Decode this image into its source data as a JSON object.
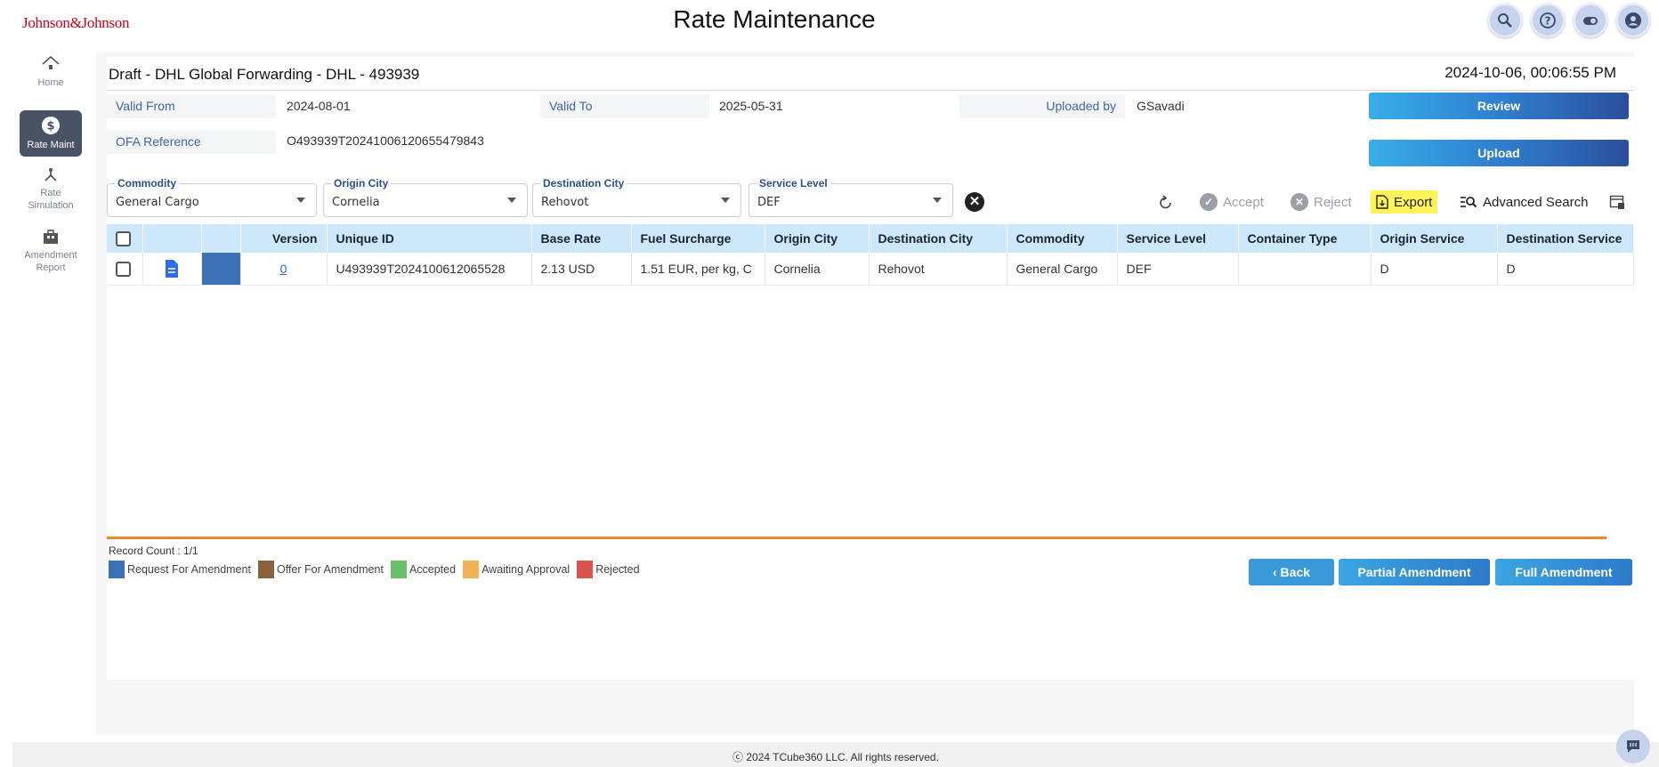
{
  "header": {
    "brand": "Johnson&Johnson",
    "title": "Rate Maintenance",
    "icons": [
      "search-icon",
      "help-icon",
      "toggle-icon",
      "user-icon"
    ]
  },
  "sidebar": {
    "items": [
      {
        "label": "Home",
        "icon": "home-icon"
      },
      {
        "label": "Rate Maint",
        "icon": "dollar-icon",
        "active": true
      },
      {
        "label": "Rate Simulation",
        "icon": "simulation-icon"
      },
      {
        "label": "Amendment Report",
        "icon": "report-icon"
      }
    ]
  },
  "draft": {
    "title": "Draft - DHL Global Forwarding - DHL - 493939",
    "timestamp": "2024-10-06, 00:06:55 PM"
  },
  "info": {
    "valid_from_label": "Valid From",
    "valid_from": "2024-08-01",
    "valid_to_label": "Valid To",
    "valid_to": "2025-05-31",
    "uploaded_by_label": "Uploaded by",
    "uploaded_by": "GSavadi",
    "ofa_label": "OFA Reference",
    "ofa": "O493939T20241006120655479843"
  },
  "actions": {
    "review": "Review",
    "upload": "Upload"
  },
  "filters": {
    "commodity": {
      "label": "Commodity",
      "value": "General Cargo"
    },
    "origin_city": {
      "label": "Origin City",
      "value": "Cornelia"
    },
    "destination_city": {
      "label": "Destination City",
      "value": "Rehovot"
    },
    "service_level": {
      "label": "Service Level",
      "value": "DEF"
    }
  },
  "toolbar": {
    "accept": "Accept",
    "reject": "Reject",
    "export": "Export",
    "advanced_search": "Advanced Search"
  },
  "table": {
    "headers": [
      "Version",
      "Unique ID",
      "Base Rate",
      "Fuel Surcharge",
      "Origin City",
      "Destination City",
      "Commodity",
      "Service Level",
      "Container Type",
      "Origin Service",
      "Destination Service"
    ],
    "rows": [
      {
        "version": "0",
        "unique_id": "U493939T2024100612065528",
        "base_rate": "2.13 USD",
        "fuel_surcharge": "1.51 EUR, per kg, C",
        "origin_city": "Cornelia",
        "destination_city": "Rehovot",
        "commodity": "General Cargo",
        "service_level": "DEF",
        "container_type": "",
        "origin_service": "D",
        "destination_service": "D",
        "status_color": "#3c71b6"
      }
    ]
  },
  "record_count": "Record Count : 1/1",
  "legend": [
    {
      "label": "Request For Amendment",
      "color": "#3c71b6"
    },
    {
      "label": "Offer For Amendment",
      "color": "#8b6239"
    },
    {
      "label": "Accepted",
      "color": "#6abf69"
    },
    {
      "label": "Awaiting Approval",
      "color": "#f0b358"
    },
    {
      "label": "Rejected",
      "color": "#d9534f"
    }
  ],
  "bottom_buttons": {
    "back": "Back",
    "partial": "Partial Amendment",
    "full": "Full Amendment"
  },
  "footer": "ⓒ 2024 TCube360 LLC. All rights reserved."
}
